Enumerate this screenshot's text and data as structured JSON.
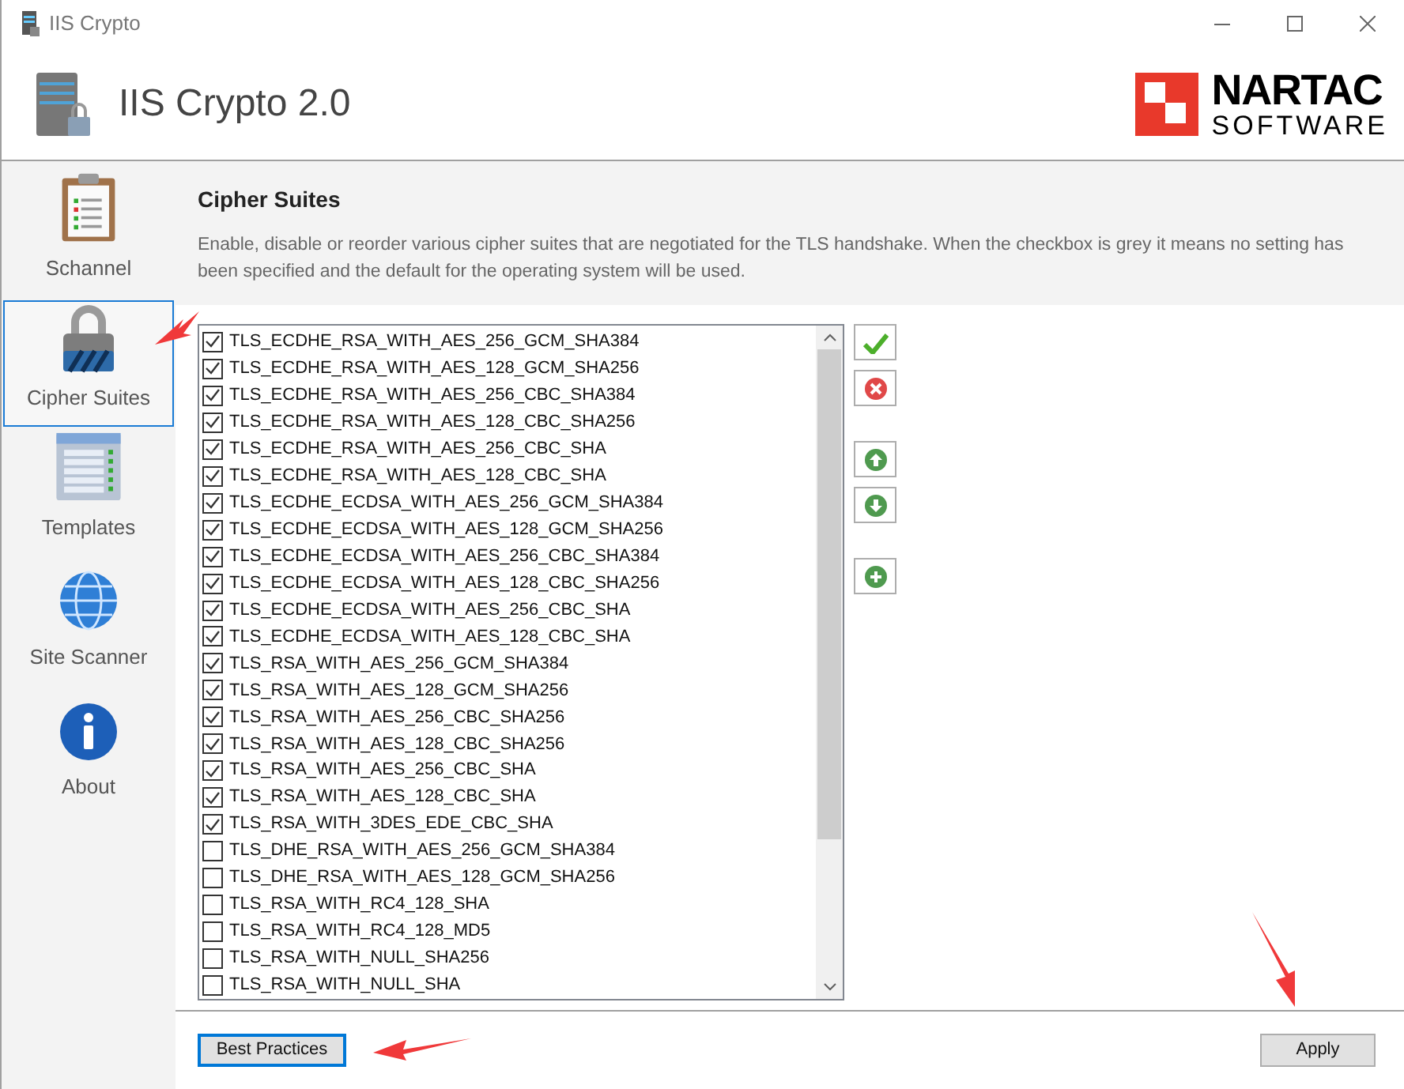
{
  "window": {
    "title": "IIS Crypto"
  },
  "header": {
    "app_title": "IIS Crypto 2.0",
    "logo_top": "NARTAC",
    "logo_bottom": "SOFTWARE"
  },
  "sidebar": {
    "items": [
      {
        "label": "Schannel",
        "kind": "clipboard",
        "selected": false
      },
      {
        "label": "Cipher Suites",
        "kind": "lock",
        "selected": true
      },
      {
        "label": "Templates",
        "kind": "list",
        "selected": false
      },
      {
        "label": "Site Scanner",
        "kind": "globe",
        "selected": false
      },
      {
        "label": "About",
        "kind": "info",
        "selected": false
      }
    ]
  },
  "section": {
    "title": "Cipher Suites",
    "description": "Enable, disable or reorder various cipher suites that are negotiated for the TLS handshake. When the checkbox is grey it means no setting has been specified and the default for the operating system will be used."
  },
  "cipher_suites": [
    {
      "name": "TLS_ECDHE_RSA_WITH_AES_256_GCM_SHA384",
      "checked": true
    },
    {
      "name": "TLS_ECDHE_RSA_WITH_AES_128_GCM_SHA256",
      "checked": true
    },
    {
      "name": "TLS_ECDHE_RSA_WITH_AES_256_CBC_SHA384",
      "checked": true
    },
    {
      "name": "TLS_ECDHE_RSA_WITH_AES_128_CBC_SHA256",
      "checked": true
    },
    {
      "name": "TLS_ECDHE_RSA_WITH_AES_256_CBC_SHA",
      "checked": true
    },
    {
      "name": "TLS_ECDHE_RSA_WITH_AES_128_CBC_SHA",
      "checked": true
    },
    {
      "name": "TLS_ECDHE_ECDSA_WITH_AES_256_GCM_SHA384",
      "checked": true
    },
    {
      "name": "TLS_ECDHE_ECDSA_WITH_AES_128_GCM_SHA256",
      "checked": true
    },
    {
      "name": "TLS_ECDHE_ECDSA_WITH_AES_256_CBC_SHA384",
      "checked": true
    },
    {
      "name": "TLS_ECDHE_ECDSA_WITH_AES_128_CBC_SHA256",
      "checked": true
    },
    {
      "name": "TLS_ECDHE_ECDSA_WITH_AES_256_CBC_SHA",
      "checked": true
    },
    {
      "name": "TLS_ECDHE_ECDSA_WITH_AES_128_CBC_SHA",
      "checked": true
    },
    {
      "name": "TLS_RSA_WITH_AES_256_GCM_SHA384",
      "checked": true
    },
    {
      "name": "TLS_RSA_WITH_AES_128_GCM_SHA256",
      "checked": true
    },
    {
      "name": "TLS_RSA_WITH_AES_256_CBC_SHA256",
      "checked": true
    },
    {
      "name": "TLS_RSA_WITH_AES_128_CBC_SHA256",
      "checked": true
    },
    {
      "name": "TLS_RSA_WITH_AES_256_CBC_SHA",
      "checked": true
    },
    {
      "name": "TLS_RSA_WITH_AES_128_CBC_SHA",
      "checked": true
    },
    {
      "name": "TLS_RSA_WITH_3DES_EDE_CBC_SHA",
      "checked": true
    },
    {
      "name": "TLS_DHE_RSA_WITH_AES_256_GCM_SHA384",
      "checked": false
    },
    {
      "name": "TLS_DHE_RSA_WITH_AES_128_GCM_SHA256",
      "checked": false
    },
    {
      "name": "TLS_RSA_WITH_RC4_128_SHA",
      "checked": false
    },
    {
      "name": "TLS_RSA_WITH_RC4_128_MD5",
      "checked": false
    },
    {
      "name": "TLS_RSA_WITH_NULL_SHA256",
      "checked": false
    },
    {
      "name": "TLS_RSA_WITH_NULL_SHA",
      "checked": false
    }
  ],
  "list_tools": [
    {
      "kind": "check_all"
    },
    {
      "kind": "uncheck_all"
    },
    {
      "kind": "move_up"
    },
    {
      "kind": "move_down"
    },
    {
      "kind": "add"
    }
  ],
  "footer": {
    "buttons": [
      {
        "label": "Best Practices",
        "kind": "focused"
      },
      {
        "label": "Apply",
        "kind": "plain"
      }
    ]
  }
}
